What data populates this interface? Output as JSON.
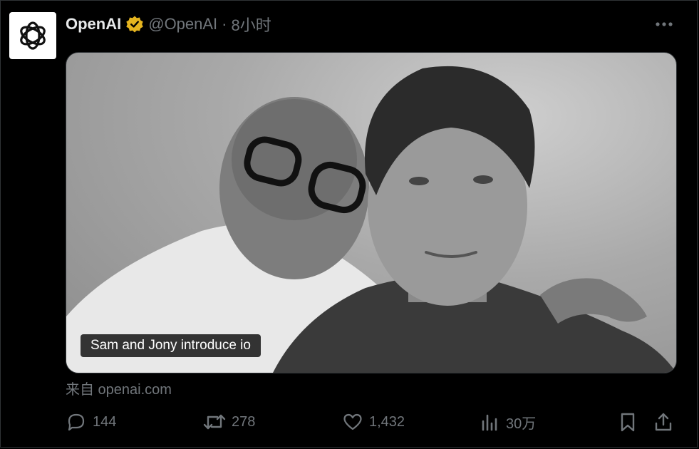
{
  "post": {
    "author_name": "OpenAI",
    "handle": "@OpenAI",
    "separator": "·",
    "time": "8小时"
  },
  "media": {
    "caption": "Sam and Jony introduce io"
  },
  "source": {
    "text": "来自 openai.com"
  },
  "actions": {
    "replies": "144",
    "reposts": "278",
    "likes": "1,432",
    "views": "30万"
  },
  "icons": {
    "logo": "openai-logo-icon",
    "verified": "verified-badge-icon",
    "more": "more-icon",
    "reply": "reply-icon",
    "repost": "repost-icon",
    "like": "heart-icon",
    "views": "views-icon",
    "bookmark": "bookmark-icon",
    "share": "share-icon"
  },
  "colors": {
    "background": "#000000",
    "text": "#e7e9ea",
    "muted": "#71767b",
    "verified": "#e5b41f"
  }
}
